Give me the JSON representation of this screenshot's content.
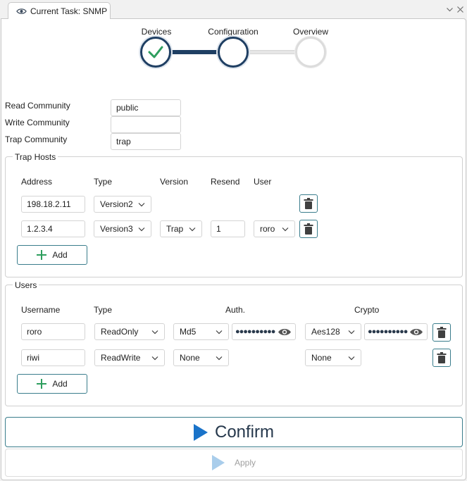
{
  "tab": {
    "title": "Current Task: SNMP"
  },
  "stepper": {
    "steps": [
      {
        "label": "Devices",
        "state": "done"
      },
      {
        "label": "Configuration",
        "state": "current"
      },
      {
        "label": "Overview",
        "state": "pending"
      }
    ]
  },
  "community": {
    "read_label": "Read Community",
    "read_value": "public",
    "write_label": "Write Community",
    "write_value": "",
    "trap_label": "Trap Community",
    "trap_value": "trap"
  },
  "trap_hosts": {
    "title": "Trap Hosts",
    "headers": {
      "address": "Address",
      "type": "Type",
      "version": "Version",
      "resend": "Resend",
      "user": "User"
    },
    "rows": [
      {
        "address": "198.18.2.11",
        "type": "Version2"
      },
      {
        "address": "1.2.3.4",
        "type": "Version3",
        "version": "Trap",
        "resend": "1",
        "user": "roro"
      }
    ],
    "add_label": "Add"
  },
  "users": {
    "title": "Users",
    "headers": {
      "username": "Username",
      "type": "Type",
      "auth": "Auth.",
      "crypto": "Crypto"
    },
    "rows": [
      {
        "username": "roro",
        "type": "ReadOnly",
        "auth": "Md5",
        "auth_password": "●●●●●●●●●●",
        "crypto": "Aes128",
        "crypto_password": "●●●●●●●●●●"
      },
      {
        "username": "riwi",
        "type": "ReadWrite",
        "auth": "None",
        "crypto": "None"
      }
    ],
    "add_label": "Add"
  },
  "actions": {
    "confirm_label": "Confirm",
    "apply_label": "Apply"
  },
  "colors": {
    "accent": "#1f3f63",
    "success": "#2e9e5e",
    "play": "#1a73c9",
    "border": "#3a7d8c"
  }
}
